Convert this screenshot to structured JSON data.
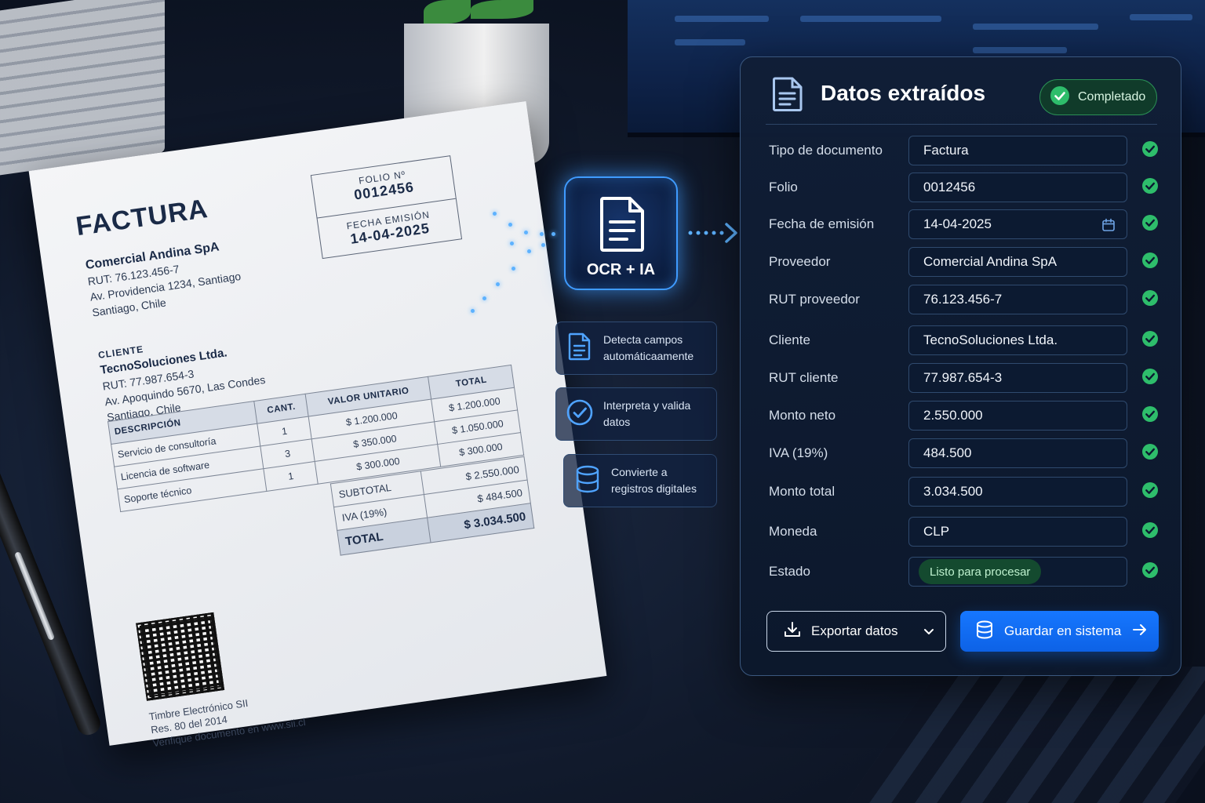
{
  "colors": {
    "accent_blue": "#1677ff",
    "success_green": "#2ebd6b",
    "panel_bg": "#0f1d36",
    "glow": "#3f9bff"
  },
  "invoice": {
    "title": "FACTURA",
    "issuer": {
      "name": "Comercial Andina SpA",
      "rut": "RUT: 76.123.456-7",
      "address": "Av. Providencia 1234, Santiago",
      "city": "Santiago, Chile"
    },
    "folio_label": "FOLIO Nº",
    "folio_value": "0012456",
    "date_label": "FECHA EMISIÓN",
    "date_value": "14-04-2025",
    "client": {
      "header": "CLIENTE",
      "name": "TecnoSoluciones Ltda.",
      "rut": "RUT: 77.987.654-3",
      "address": "Av. Apoquindo 5670, Las Condes",
      "city": "Santiago, Chile"
    },
    "columns": [
      "DESCRIPCIÓN",
      "CANT.",
      "VALOR UNITARIO",
      "TOTAL"
    ],
    "items": [
      [
        "Servicio de consultoría",
        "1",
        "$ 1.200.000",
        "$ 1.200.000"
      ],
      [
        "Licencia de software",
        "3",
        "$ 350.000",
        "$ 1.050.000"
      ],
      [
        "Soporte técnico",
        "1",
        "$ 300.000",
        "$ 300.000"
      ]
    ],
    "subtotal_label": "SUBTOTAL",
    "subtotal_value": "$ 2.550.000",
    "iva_label": "IVA (19%)",
    "iva_value": "$ 484.500",
    "total_label": "TOTAL",
    "total_value": "$ 3.034.500",
    "stamp_line1": "Timbre Electrónico SII",
    "stamp_line2": "Res. 80 del 2014",
    "stamp_line3": "Verifique documento en www.sii.cl"
  },
  "ocr": {
    "label": "OCR + IA",
    "icon": "document-icon"
  },
  "features": [
    {
      "icon": "document-icon",
      "text1": "Detecta campos",
      "text2": "automáticaamente"
    },
    {
      "icon": "check-circle-icon",
      "text1": "Interpreta y valida",
      "text2": "datos"
    },
    {
      "icon": "database-icon",
      "text1": "Convierte a",
      "text2": "registros digitales"
    }
  ],
  "panel": {
    "title": "Datos extraídos",
    "badge": "Completado",
    "fields": [
      {
        "label": "Tipo de documento",
        "value": "Factura"
      },
      {
        "label": "Folio",
        "value": "0012456"
      },
      {
        "label": "Fecha de emisión",
        "value": "14-04-2025",
        "icon": "calendar-icon"
      },
      {
        "label": "Proveedor",
        "value": "Comercial Andina SpA"
      },
      {
        "label": "RUT proveedor",
        "value": "76.123.456-7"
      },
      {
        "label": "Cliente",
        "value": "TecnoSoluciones Ltda."
      },
      {
        "label": "RUT cliente",
        "value": "77.987.654-3"
      },
      {
        "label": "Monto neto",
        "value": "2.550.000"
      },
      {
        "label": "IVA (19%)",
        "value": "484.500"
      },
      {
        "label": "Monto total",
        "value": "3.034.500"
      },
      {
        "label": "Moneda",
        "value": "CLP"
      },
      {
        "label": "Estado",
        "value": "Listo para procesar"
      }
    ],
    "export_label": "Exportar datos",
    "save_label": "Guardar en sistema"
  }
}
